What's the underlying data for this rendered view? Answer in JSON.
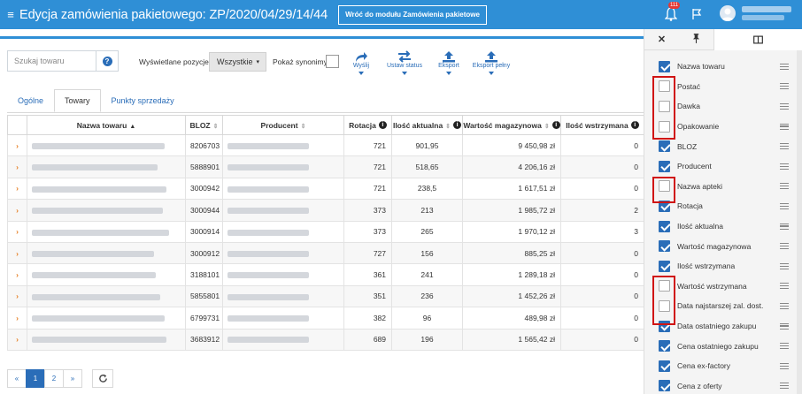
{
  "header": {
    "title": "Edycja zamówienia pakietowego: ZP/2020/04/29/14/44",
    "back_button": "Wróć do modułu Zamówienia pakietowe",
    "bell_badge": "111"
  },
  "toolbar": {
    "search_placeholder": "Szukaj towaru",
    "help_label": "?",
    "shown_label": "Wyświetlane pozycje",
    "shown_value": "Wszystkie",
    "synonyms_label": "Pokaż synonimy",
    "synonyms_checked": false,
    "send_label": "Wyślij",
    "status_label": "Ustaw status",
    "export_label": "Eksport",
    "export_full_label": "Eksport pełny"
  },
  "tabs": [
    {
      "label": "Ogólne",
      "active": false
    },
    {
      "label": "Towary",
      "active": true
    },
    {
      "label": "Punkty sprzedaży",
      "active": false
    }
  ],
  "table": {
    "columns": [
      "Nazwa towaru",
      "BLOZ",
      "Producent",
      "Rotacja",
      "Ilość aktualna",
      "Wartość magazynowa",
      "Ilość wstrzymana"
    ],
    "rows": [
      {
        "bloz": "8206703",
        "rotacja": "721",
        "ilosc": "901,95",
        "wartosc": "9 450,98 zł",
        "wstrzymana": "0"
      },
      {
        "bloz": "5888901",
        "rotacja": "721",
        "ilosc": "518,65",
        "wartosc": "4 206,16 zł",
        "wstrzymana": "0"
      },
      {
        "bloz": "3000942",
        "rotacja": "721",
        "ilosc": "238,5",
        "wartosc": "1 617,51 zł",
        "wstrzymana": "0"
      },
      {
        "bloz": "3000944",
        "rotacja": "373",
        "ilosc": "213",
        "wartosc": "1 985,72 zł",
        "wstrzymana": "2"
      },
      {
        "bloz": "3000914",
        "rotacja": "373",
        "ilosc": "265",
        "wartosc": "1 970,12 zł",
        "wstrzymana": "3"
      },
      {
        "bloz": "3000912",
        "rotacja": "727",
        "ilosc": "156",
        "wartosc": "885,25 zł",
        "wstrzymana": "0"
      },
      {
        "bloz": "3188101",
        "rotacja": "361",
        "ilosc": "241",
        "wartosc": "1 289,18 zł",
        "wstrzymana": "0"
      },
      {
        "bloz": "5855801",
        "rotacja": "351",
        "ilosc": "236",
        "wartosc": "1 452,26 zł",
        "wstrzymana": "0"
      },
      {
        "bloz": "6799731",
        "rotacja": "382",
        "ilosc": "96",
        "wartosc": "489,98 zł",
        "wstrzymana": "0"
      },
      {
        "bloz": "3683912",
        "rotacja": "689",
        "ilosc": "196",
        "wartosc": "1 565,42 zł",
        "wstrzymana": "0"
      }
    ]
  },
  "pager": {
    "prev": "«",
    "pages": [
      "1",
      "2"
    ],
    "next": "»",
    "active": "1"
  },
  "columns_panel": {
    "items": [
      {
        "label": "Nazwa towaru",
        "checked": true
      },
      {
        "label": "Postać",
        "checked": false
      },
      {
        "label": "Dawka",
        "checked": false
      },
      {
        "label": "Opakowanie",
        "checked": false
      },
      {
        "label": "BLOZ",
        "checked": true
      },
      {
        "label": "Producent",
        "checked": true
      },
      {
        "label": "Nazwa apteki",
        "checked": false
      },
      {
        "label": "Rotacja",
        "checked": true
      },
      {
        "label": "Ilość aktualna",
        "checked": true
      },
      {
        "label": "Wartość magazynowa",
        "checked": true
      },
      {
        "label": "Ilość wstrzymana",
        "checked": true
      },
      {
        "label": "Wartość wstrzymana",
        "checked": false
      },
      {
        "label": "Data najstarszej zal. dost.",
        "checked": false
      },
      {
        "label": "Data ostatniego zakupu",
        "checked": true
      },
      {
        "label": "Cena ostatniego zakupu",
        "checked": true
      },
      {
        "label": "Cena ex-factory",
        "checked": true
      },
      {
        "label": "Cena z oferty",
        "checked": true
      }
    ]
  },
  "colors": {
    "accent": "#2f8fd6",
    "link": "#2a6db8",
    "expander": "#e67e22",
    "highlight": "#d01515"
  }
}
